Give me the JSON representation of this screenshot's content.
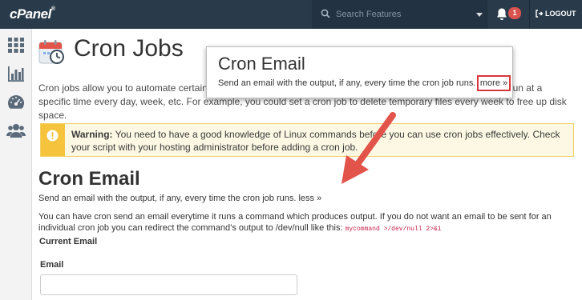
{
  "topbar": {
    "logo": "cPanel",
    "logo_mark": "®",
    "search_placeholder": "Search Features",
    "notification_count": "1",
    "logout_label": "LOGOUT"
  },
  "sidebar": {
    "items": [
      {
        "icon": "grid-icon"
      },
      {
        "icon": "bar-chart-icon"
      },
      {
        "icon": "dashboard-icon"
      },
      {
        "icon": "users-icon"
      }
    ]
  },
  "page": {
    "title": "Cron Jobs",
    "intro": "Cron jobs allow you to automate certain commands or scripts on your site. You can set a command or script to run at a specific time every day, week, etc. For example, you could set a cron job to delete temporary files every week to free up disk space.",
    "warning_label": "Warning:",
    "warning_text": " You need to have a good knowledge of Linux commands before you can use cron jobs effectively. Check your script with your hosting administrator before adding a cron job."
  },
  "cron_email": {
    "title": "Cron Email",
    "desc": "Send an email with the output, if any, every time the cron job runs. ",
    "less_link": "less »",
    "body_text": "You can have cron send an email everytime it runs a command which produces output. If you do not want an email to be sent for an individual cron job you can redirect the command’s output to /dev/null like this: ",
    "code_example": "mycommand >/dev/null 2>&1",
    "current_email_label": "Current Email",
    "email_label": "Email",
    "email_value": ""
  },
  "callout": {
    "title": "Cron Email",
    "desc": "Send an email with the output, if any, every time the cron job runs.",
    "more_link": "more »"
  },
  "colors": {
    "topbar": "#293a4a",
    "warning_bg": "#fcf8e3",
    "warning_accent": "#f5c43c",
    "highlight": "#d9363e",
    "arrow": "#e2534a"
  }
}
